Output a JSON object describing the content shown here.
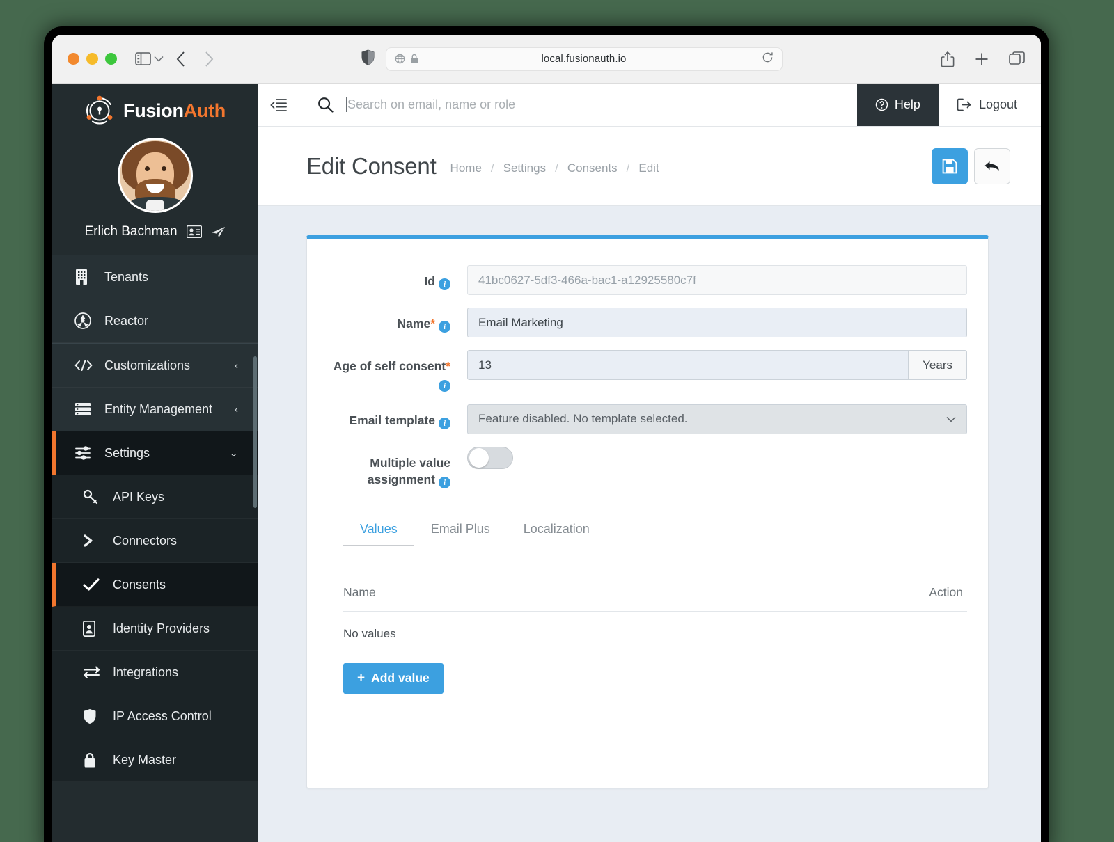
{
  "browser": {
    "url": "local.fusionauth.io",
    "icons": {
      "sidebar_toggle": "sidebar-toggle-icon",
      "chevron_down": "chevron-down-icon",
      "back": "back-arrow-icon",
      "forward": "forward-arrow-icon",
      "shield": "shield-icon",
      "globe": "globe-icon",
      "lock": "lock-icon",
      "reload": "reload-icon",
      "share": "share-icon",
      "new_tab": "plus-icon",
      "tabs": "tab-overview-icon"
    }
  },
  "sidebar": {
    "brand": {
      "first": "Fusion",
      "second": "Auth"
    },
    "user": {
      "name": "Erlich Bachman"
    },
    "groups": [
      {
        "items": [
          {
            "label": "Tenants",
            "icon": "building-icon",
            "chevron": ""
          },
          {
            "label": "Reactor",
            "icon": "reactor-icon",
            "chevron": ""
          }
        ]
      },
      {
        "items": [
          {
            "label": "Customizations",
            "icon": "code-icon",
            "chevron": "‹"
          },
          {
            "label": "Entity Management",
            "icon": "servers-icon",
            "chevron": "‹"
          }
        ]
      }
    ],
    "settings": {
      "label": "Settings",
      "icon": "sliders-icon",
      "chevron": "⌄"
    },
    "sub_items": [
      {
        "label": "API Keys",
        "icon": "key-icon"
      },
      {
        "label": "Connectors",
        "icon": "chevron-right-icon"
      },
      {
        "label": "Consents",
        "icon": "check-icon"
      },
      {
        "label": "Identity Providers",
        "icon": "id-card-icon"
      },
      {
        "label": "Integrations",
        "icon": "exchange-icon"
      },
      {
        "label": "IP Access Control",
        "icon": "shield-icon"
      },
      {
        "label": "Key Master",
        "icon": "lock-icon"
      }
    ]
  },
  "topbar": {
    "search_placeholder": "Search on email, name or role",
    "search_value": "",
    "help_label": "Help",
    "logout_label": "Logout"
  },
  "page": {
    "title": "Edit Consent",
    "breadcrumbs": [
      "Home",
      "Settings",
      "Consents",
      "Edit"
    ],
    "separator": "/",
    "save_label": "",
    "back_label": ""
  },
  "form": {
    "id": {
      "label": "Id",
      "value": "41bc0627-5df3-466a-bac1-a12925580c7f"
    },
    "name": {
      "label": "Name",
      "required": "*",
      "value": "Email Marketing"
    },
    "age": {
      "label": "Age of self consent",
      "required": "*",
      "value": "13",
      "unit": "Years"
    },
    "email_template": {
      "label": "Email template",
      "value": "Feature disabled. No template selected.",
      "chevron": "⌄"
    },
    "multiple_value": {
      "label_line1": "Multiple value",
      "label_line2": "assignment",
      "state": "off"
    }
  },
  "tabs": [
    {
      "label": "Values",
      "active": true
    },
    {
      "label": "Email Plus",
      "active": false
    },
    {
      "label": "Localization",
      "active": false
    }
  ],
  "values_table": {
    "columns": {
      "name": "Name",
      "action": "Action"
    },
    "empty_text": "No values",
    "add_label": "Add value",
    "add_icon": "plus-icon"
  },
  "colors": {
    "accent_blue": "#3ca0e0",
    "brand_orange": "#f2762e",
    "sidebar_dark": "#232c2f",
    "page_bg": "#e8edf3",
    "desktop_bg": "#46694e"
  }
}
